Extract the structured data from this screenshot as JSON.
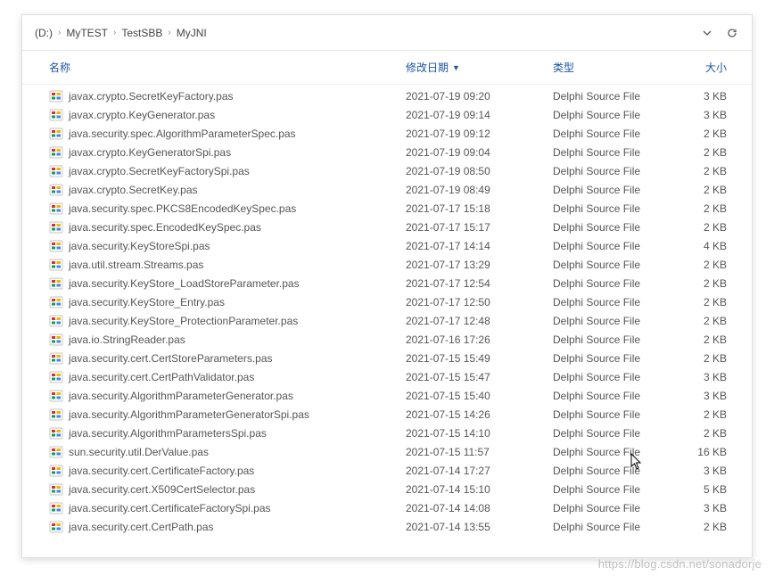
{
  "breadcrumb": {
    "drive": "(D:)",
    "segments": [
      "MyTEST",
      "TestSBB",
      "MyJNI"
    ]
  },
  "columns": {
    "name": "名称",
    "date": "修改日期",
    "type": "类型",
    "size": "大小"
  },
  "files": [
    {
      "name": "javax.crypto.SecretKeyFactory.pas",
      "date": "2021-07-19 09:20",
      "type": "Delphi Source File",
      "size": "3 KB"
    },
    {
      "name": "javax.crypto.KeyGenerator.pas",
      "date": "2021-07-19 09:14",
      "type": "Delphi Source File",
      "size": "3 KB"
    },
    {
      "name": "java.security.spec.AlgorithmParameterSpec.pas",
      "date": "2021-07-19 09:12",
      "type": "Delphi Source File",
      "size": "2 KB"
    },
    {
      "name": "javax.crypto.KeyGeneratorSpi.pas",
      "date": "2021-07-19 09:04",
      "type": "Delphi Source File",
      "size": "2 KB"
    },
    {
      "name": "javax.crypto.SecretKeyFactorySpi.pas",
      "date": "2021-07-19 08:50",
      "type": "Delphi Source File",
      "size": "2 KB"
    },
    {
      "name": "javax.crypto.SecretKey.pas",
      "date": "2021-07-19 08:49",
      "type": "Delphi Source File",
      "size": "2 KB"
    },
    {
      "name": "java.security.spec.PKCS8EncodedKeySpec.pas",
      "date": "2021-07-17 15:18",
      "type": "Delphi Source File",
      "size": "2 KB"
    },
    {
      "name": "java.security.spec.EncodedKeySpec.pas",
      "date": "2021-07-17 15:17",
      "type": "Delphi Source File",
      "size": "2 KB"
    },
    {
      "name": "java.security.KeyStoreSpi.pas",
      "date": "2021-07-17 14:14",
      "type": "Delphi Source File",
      "size": "4 KB"
    },
    {
      "name": "java.util.stream.Streams.pas",
      "date": "2021-07-17 13:29",
      "type": "Delphi Source File",
      "size": "2 KB"
    },
    {
      "name": "java.security.KeyStore_LoadStoreParameter.pas",
      "date": "2021-07-17 12:54",
      "type": "Delphi Source File",
      "size": "2 KB"
    },
    {
      "name": "java.security.KeyStore_Entry.pas",
      "date": "2021-07-17 12:50",
      "type": "Delphi Source File",
      "size": "2 KB"
    },
    {
      "name": "java.security.KeyStore_ProtectionParameter.pas",
      "date": "2021-07-17 12:48",
      "type": "Delphi Source File",
      "size": "2 KB"
    },
    {
      "name": "java.io.StringReader.pas",
      "date": "2021-07-16 17:26",
      "type": "Delphi Source File",
      "size": "2 KB"
    },
    {
      "name": "java.security.cert.CertStoreParameters.pas",
      "date": "2021-07-15 15:49",
      "type": "Delphi Source File",
      "size": "2 KB"
    },
    {
      "name": "java.security.cert.CertPathValidator.pas",
      "date": "2021-07-15 15:47",
      "type": "Delphi Source File",
      "size": "3 KB"
    },
    {
      "name": "java.security.AlgorithmParameterGenerator.pas",
      "date": "2021-07-15 15:40",
      "type": "Delphi Source File",
      "size": "3 KB"
    },
    {
      "name": "java.security.AlgorithmParameterGeneratorSpi.pas",
      "date": "2021-07-15 14:26",
      "type": "Delphi Source File",
      "size": "2 KB"
    },
    {
      "name": "java.security.AlgorithmParametersSpi.pas",
      "date": "2021-07-15 14:10",
      "type": "Delphi Source File",
      "size": "2 KB"
    },
    {
      "name": "sun.security.util.DerValue.pas",
      "date": "2021-07-15 11:57",
      "type": "Delphi Source File",
      "size": "16 KB"
    },
    {
      "name": "java.security.cert.CertificateFactory.pas",
      "date": "2021-07-14 17:27",
      "type": "Delphi Source File",
      "size": "3 KB"
    },
    {
      "name": "java.security.cert.X509CertSelector.pas",
      "date": "2021-07-14 15:10",
      "type": "Delphi Source File",
      "size": "5 KB"
    },
    {
      "name": "java.security.cert.CertificateFactorySpi.pas",
      "date": "2021-07-14 14:08",
      "type": "Delphi Source File",
      "size": "3 KB"
    },
    {
      "name": "java.security.cert.CertPath.pas",
      "date": "2021-07-14 13:55",
      "type": "Delphi Source File",
      "size": "2 KB"
    }
  ],
  "watermark": "https://blog.csdn.net/sonadorje"
}
